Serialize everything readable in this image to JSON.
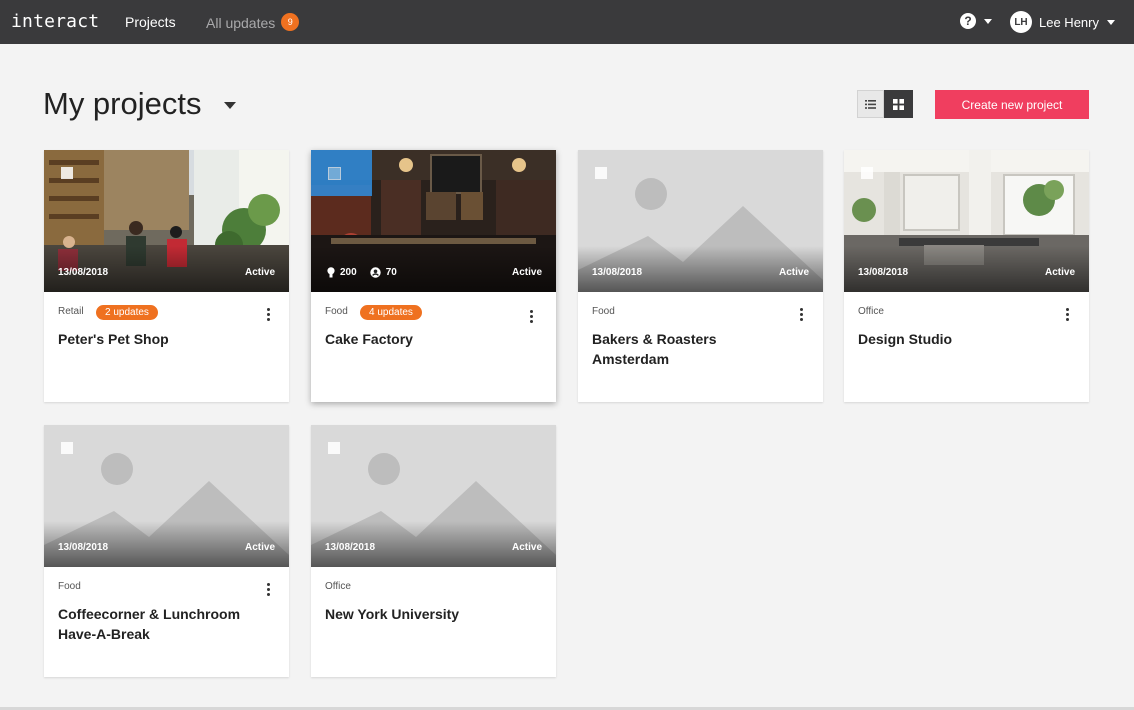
{
  "topbar": {
    "logo": "interact",
    "nav_projects": "Projects",
    "nav_updates": "All updates",
    "updates_count": "9",
    "help": "?",
    "user_initials": "LH",
    "user_name": "Lee Henry"
  },
  "header": {
    "title": "My projects",
    "create_button": "Create new project"
  },
  "cards": [
    {
      "category": "Retail",
      "updates": "2 updates",
      "name": "Peter's Pet Shop",
      "date": "13/08/2018",
      "status": "Active"
    },
    {
      "category": "Food",
      "updates": "4 updates",
      "name": "Cake Factory",
      "ideas": "200",
      "participants": "70",
      "status": "Active"
    },
    {
      "category": "Food",
      "name": "Bakers & Roasters Amsterdam",
      "date": "13/08/2018",
      "status": "Active"
    },
    {
      "category": "Office",
      "name": "Design Studio",
      "date": "13/08/2018",
      "status": "Active"
    },
    {
      "category": "Food",
      "name": "Coffeecorner & Lunchroom Have-A-Break",
      "date": "13/08/2018",
      "status": "Active"
    },
    {
      "category": "Office",
      "name": "New York University",
      "date": "13/08/2018",
      "status": "Active"
    }
  ],
  "colors": {
    "topbar": "#3a3a3c",
    "accent": "#f03e5f",
    "badge": "#ef7120",
    "selection": "#2f8ee0"
  }
}
